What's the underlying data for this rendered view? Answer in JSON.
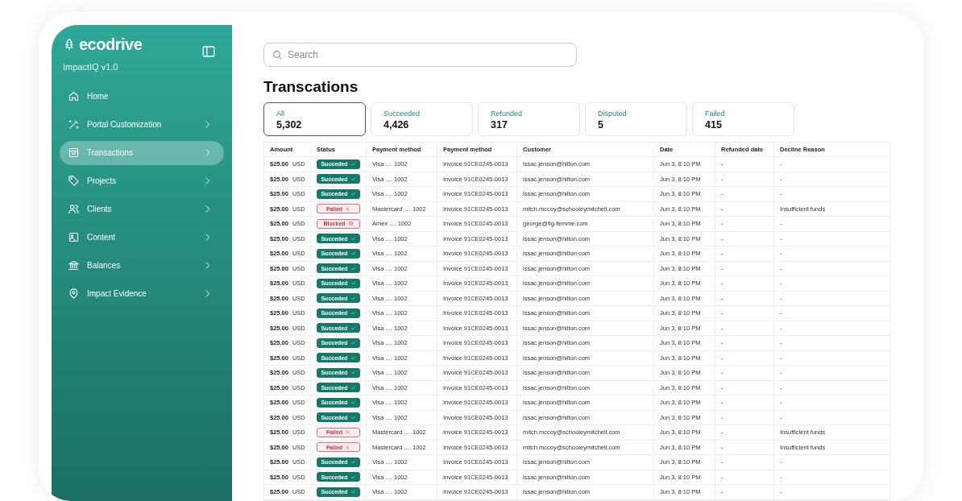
{
  "sidebar": {
    "brand": "ecodrive",
    "subtitle": "ImpactIQ v1.0",
    "items": [
      {
        "label": "Home",
        "has_arrow": false,
        "selected": false
      },
      {
        "label": "Portal Customization",
        "has_arrow": true,
        "selected": false
      },
      {
        "label": "Transactions",
        "has_arrow": true,
        "selected": true
      },
      {
        "label": "Projects",
        "has_arrow": true,
        "selected": false
      },
      {
        "label": "Clients",
        "has_arrow": true,
        "selected": false
      },
      {
        "label": "Content",
        "has_arrow": true,
        "selected": false
      },
      {
        "label": "Balances",
        "has_arrow": true,
        "selected": false
      },
      {
        "label": "Impact Evidence",
        "has_arrow": true,
        "selected": false
      }
    ]
  },
  "search": {
    "placeholder": "Search"
  },
  "title": "Transcations",
  "tabs": [
    {
      "label": "All",
      "count": "5,302",
      "selected": true
    },
    {
      "label": "Succeeded",
      "count": "4,426",
      "selected": false
    },
    {
      "label": "Refunded",
      "count": "317",
      "selected": false
    },
    {
      "label": "Disputed",
      "count": "5",
      "selected": false
    },
    {
      "label": "Failed",
      "count": "415",
      "selected": false
    }
  ],
  "table": {
    "columns": [
      "Amount",
      "Status",
      "Payment method",
      "Payment method",
      "Customer",
      "Date",
      "Refunded date",
      "Decline Reason"
    ],
    "rows": [
      {
        "amount": "$25.00",
        "currency": "USD",
        "status": {
          "kind": "succeeded",
          "label": "Succeded"
        },
        "payment": "Visa .... 1002",
        "invoice": "Invoice 91CE0245-0013",
        "customer": "issac.jenson@hilton.com",
        "date": "Jun 3, 8:10 PM",
        "refunded": "-",
        "reason": "-"
      },
      {
        "amount": "$25.00",
        "currency": "USD",
        "status": {
          "kind": "succeeded",
          "label": "Succeded"
        },
        "payment": "Visa .... 1002",
        "invoice": "Invoice 91CE0245-0013",
        "customer": "issac.jenson@hilton.com",
        "date": "Jun 3, 8:10 PM",
        "refunded": "-",
        "reason": "-"
      },
      {
        "amount": "$25.00",
        "currency": "USD",
        "status": {
          "kind": "succeeded",
          "label": "Succeded"
        },
        "payment": "Visa .... 1002",
        "invoice": "Invoice 91CE0245-0013",
        "customer": "issac.jenson@hilton.com",
        "date": "Jun 3, 8:10 PM",
        "refunded": "-",
        "reason": "-"
      },
      {
        "amount": "$25.00",
        "currency": "USD",
        "status": {
          "kind": "failed",
          "label": "Failed"
        },
        "payment": "Mastercard .... 1002",
        "invoice": "Invoice 91CE0245-0013",
        "customer": "mitch.mccoy@schooleymitchell.com",
        "date": "Jun 3, 8:10 PM",
        "refunded": "-",
        "reason": "Insufficient funds"
      },
      {
        "amount": "$25.00",
        "currency": "USD",
        "status": {
          "kind": "blocked",
          "label": "Blocked"
        },
        "payment": "Amex .... 1002",
        "invoice": "Invoice 91CE0245-0013",
        "customer": "george@fig-femme.com",
        "date": "Jun 3, 8:10 PM",
        "refunded": "-",
        "reason": "-"
      },
      {
        "amount": "$25.00",
        "currency": "USD",
        "status": {
          "kind": "succeeded",
          "label": "Succeded"
        },
        "payment": "Visa .... 1002",
        "invoice": "Invoice 91CE0245-0013",
        "customer": "issac.jenson@hilton.com",
        "date": "Jun 3, 8:10 PM",
        "refunded": "-",
        "reason": "-"
      },
      {
        "amount": "$25.00",
        "currency": "USD",
        "status": {
          "kind": "succeeded",
          "label": "Succeded"
        },
        "payment": "Visa .... 1002",
        "invoice": "Invoice 91CE0245-0013",
        "customer": "issac.jenson@hilton.com",
        "date": "Jun 3, 8:10 PM",
        "refunded": "-",
        "reason": "-"
      },
      {
        "amount": "$25.00",
        "currency": "USD",
        "status": {
          "kind": "succeeded",
          "label": "Succeded"
        },
        "payment": "Visa .... 1002",
        "invoice": "Invoice 91CE0245-0013",
        "customer": "issac.jenson@hilton.com",
        "date": "Jun 3, 8:10 PM",
        "refunded": "-",
        "reason": "-"
      },
      {
        "amount": "$25.00",
        "currency": "USD",
        "status": {
          "kind": "succeeded",
          "label": "Succeded"
        },
        "payment": "Visa .... 1002",
        "invoice": "Invoice 91CE0245-0013",
        "customer": "issac.jenson@hilton.com",
        "date": "Jun 3, 8:10 PM",
        "refunded": "-",
        "reason": "-"
      },
      {
        "amount": "$25.00",
        "currency": "USD",
        "status": {
          "kind": "succeeded",
          "label": "Succeded"
        },
        "payment": "Visa .... 1002",
        "invoice": "Invoice 91CE0245-0013",
        "customer": "issac.jenson@hilton.com",
        "date": "Jun 3, 8:10 PM",
        "refunded": "-",
        "reason": "-"
      },
      {
        "amount": "$25.00",
        "currency": "USD",
        "status": {
          "kind": "succeeded",
          "label": "Succeded"
        },
        "payment": "Visa .... 1002",
        "invoice": "Invoice 91CE0245-0013",
        "customer": "issac.jenson@hilton.com",
        "date": "Jun 3, 8:10 PM",
        "refunded": "-",
        "reason": "-"
      },
      {
        "amount": "$25.00",
        "currency": "USD",
        "status": {
          "kind": "succeeded",
          "label": "Succeded"
        },
        "payment": "Visa .... 1002",
        "invoice": "Invoice 91CE0245-0013",
        "customer": "issac.jenson@hilton.com",
        "date": "Jun 3, 8:10 PM",
        "refunded": "-",
        "reason": "-"
      },
      {
        "amount": "$25.00",
        "currency": "USD",
        "status": {
          "kind": "succeeded",
          "label": "Succeded"
        },
        "payment": "Visa .... 1002",
        "invoice": "Invoice 91CE0245-0013",
        "customer": "issac.jenson@hilton.com",
        "date": "Jun 3, 8:10 PM",
        "refunded": "-",
        "reason": "-"
      },
      {
        "amount": "$25.00",
        "currency": "USD",
        "status": {
          "kind": "succeeded",
          "label": "Succeded"
        },
        "payment": "Visa .... 1002",
        "invoice": "Invoice 91CE0245-0013",
        "customer": "issac.jenson@hilton.com",
        "date": "Jun 3, 8:10 PM",
        "refunded": "-",
        "reason": "-"
      },
      {
        "amount": "$25.00",
        "currency": "USD",
        "status": {
          "kind": "succeeded",
          "label": "Succeded"
        },
        "payment": "Visa .... 1002",
        "invoice": "Invoice 91CE0245-0013",
        "customer": "issac.jenson@hilton.com",
        "date": "Jun 3, 8:10 PM",
        "refunded": "-",
        "reason": "-"
      },
      {
        "amount": "$25.00",
        "currency": "USD",
        "status": {
          "kind": "succeeded",
          "label": "Succeded"
        },
        "payment": "Visa .... 1002",
        "invoice": "Invoice 91CE0245-0013",
        "customer": "issac.jenson@hilton.com",
        "date": "Jun 3, 8:10 PM",
        "refunded": "-",
        "reason": "-"
      },
      {
        "amount": "$25.00",
        "currency": "USD",
        "status": {
          "kind": "succeeded",
          "label": "Succeded"
        },
        "payment": "Visa .... 1002",
        "invoice": "Invoice 91CE0245-0013",
        "customer": "issac.jenson@hilton.com",
        "date": "Jun 3, 8:10 PM",
        "refunded": "-",
        "reason": "-"
      },
      {
        "amount": "$25.00",
        "currency": "USD",
        "status": {
          "kind": "succeeded",
          "label": "Succeded"
        },
        "payment": "Visa .... 1002",
        "invoice": "Invoice 91CE0245-0013",
        "customer": "issac.jenson@hilton.com",
        "date": "Jun 3, 8:10 PM",
        "refunded": "-",
        "reason": "-"
      },
      {
        "amount": "$25.00",
        "currency": "USD",
        "status": {
          "kind": "failed",
          "label": "Failed"
        },
        "payment": "Mastercard .... 1002",
        "invoice": "Invoice 91CE0245-0013",
        "customer": "mitch.mccoy@schooleymitchell.com",
        "date": "Jun 3, 8:10 PM",
        "refunded": "-",
        "reason": "Insufficient funds"
      },
      {
        "amount": "$25.00",
        "currency": "USD",
        "status": {
          "kind": "failed",
          "label": "Failed"
        },
        "payment": "Mastercard .... 1002",
        "invoice": "Invoice 91CE0245-0013",
        "customer": "mitch.mccoy@schooleymitchell.com",
        "date": "Jun 3, 8:10 PM",
        "refunded": "-",
        "reason": "Insufficient funds"
      },
      {
        "amount": "$25.00",
        "currency": "USD",
        "status": {
          "kind": "succeeded",
          "label": "Succeded"
        },
        "payment": "Visa .... 1002",
        "invoice": "Invoice 91CE0245-0013",
        "customer": "issac.jenson@hilton.com",
        "date": "Jun 3, 8:10 PM",
        "refunded": "-",
        "reason": "-"
      },
      {
        "amount": "$25.00",
        "currency": "USD",
        "status": {
          "kind": "succeeded",
          "label": "Succeded"
        },
        "payment": "Visa .... 1002",
        "invoice": "Invoice 91CE0245-0013",
        "customer": "issac.jenson@hilton.com",
        "date": "Jun 3, 8:10 PM",
        "refunded": "-",
        "reason": "-"
      },
      {
        "amount": "$25.00",
        "currency": "USD",
        "status": {
          "kind": "succeeded",
          "label": "Succeded"
        },
        "payment": "Visa .... 1002",
        "invoice": "Invoice 91CE0245-0013",
        "customer": "issac.jenson@hilton.com",
        "date": "Jun 3, 8:10 PM",
        "refunded": "-",
        "reason": "-"
      }
    ]
  }
}
